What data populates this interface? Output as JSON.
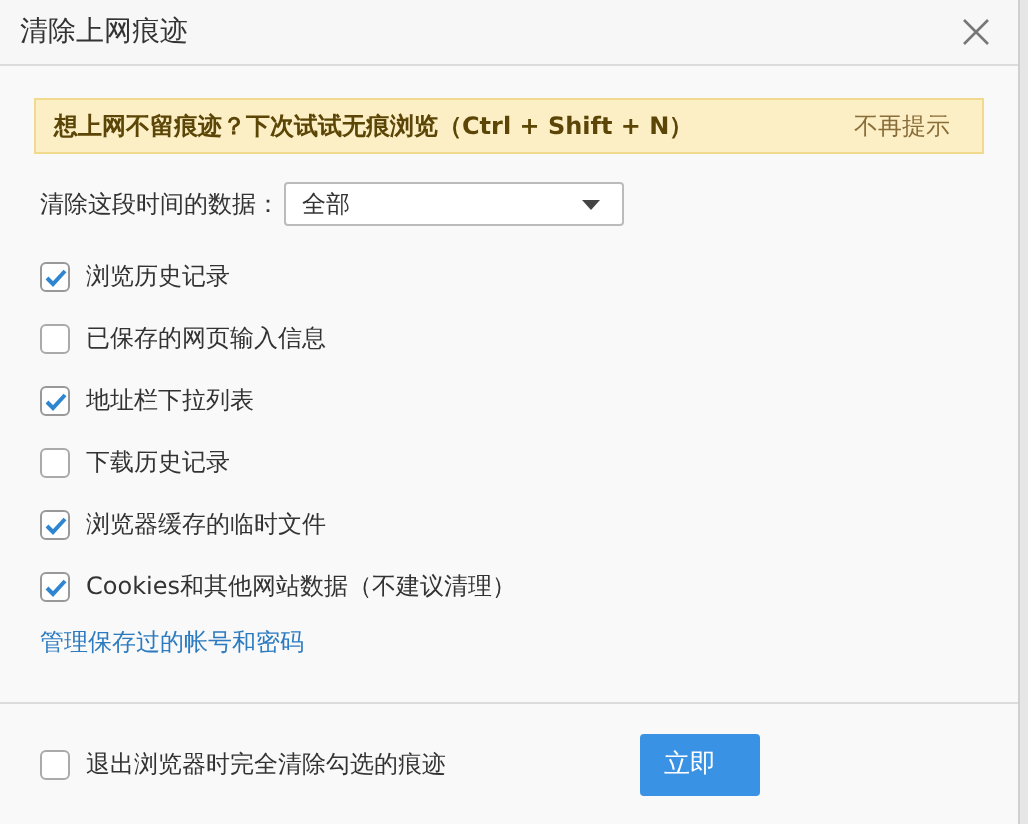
{
  "window": {
    "title": "清除上网痕迹"
  },
  "banner": {
    "text": "想上网不留痕迹？下次试试无痕浏览（Ctrl + Shift + N）",
    "dismiss": "不再提示"
  },
  "range": {
    "label": "清除这段时间的数据：",
    "value": "全部"
  },
  "options": [
    {
      "label": "浏览历史记录",
      "checked": true
    },
    {
      "label": "已保存的网页输入信息",
      "checked": false
    },
    {
      "label": "地址栏下拉列表",
      "checked": true
    },
    {
      "label": "下载历史记录",
      "checked": false
    },
    {
      "label": "浏览器缓存的临时文件",
      "checked": true
    },
    {
      "label": "Cookies和其他网站数据（不建议清理）",
      "checked": true
    }
  ],
  "manage_link": "管理保存过的帐号和密码",
  "footer": {
    "option": {
      "label": "退出浏览器时完全清除勾选的痕迹",
      "checked": false
    },
    "button": "立即"
  }
}
